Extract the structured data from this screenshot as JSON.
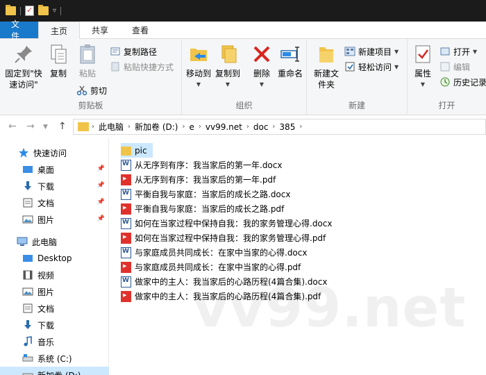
{
  "titlebar": {
    "title": ""
  },
  "tabs": [
    "文件",
    "主页",
    "共享",
    "查看"
  ],
  "ribbon": {
    "clipboard": {
      "pin": "固定到\"快速访问\"",
      "copy": "复制",
      "paste": "粘贴",
      "copy_path": "复制路径",
      "paste_shortcut": "粘贴快捷方式",
      "cut": "剪切",
      "label": "剪贴板"
    },
    "organize": {
      "move_to": "移动到",
      "copy_to": "复制到",
      "delete": "删除",
      "rename": "重命名",
      "label": "组织"
    },
    "new": {
      "new_folder": "新建文件夹",
      "new_item": "新建项目",
      "easy_access": "轻松访问",
      "label": "新建"
    },
    "open": {
      "properties": "属性",
      "open": "打开",
      "edit": "编辑",
      "history": "历史记录",
      "label": "打开"
    }
  },
  "address": {
    "crumbs": [
      "此电脑",
      "新加卷 (D:)",
      "e",
      "vv99.net",
      "doc",
      "385"
    ]
  },
  "navpane": {
    "quick_access": "快速访问",
    "quick_items": [
      "桌面",
      "下载",
      "文档",
      "图片"
    ],
    "this_pc": "此电脑",
    "pc_items": [
      "Desktop",
      "视频",
      "图片",
      "文档",
      "下载",
      "音乐",
      "系统 (C:)",
      "新加卷 (D:)"
    ]
  },
  "files": [
    {
      "name": "pic",
      "type": "folder"
    },
    {
      "name": "从无序到有序：我当家后的第一年.docx",
      "type": "docx"
    },
    {
      "name": "从无序到有序：我当家后的第一年.pdf",
      "type": "pdf"
    },
    {
      "name": "平衡自我与家庭：当家后的成长之路.docx",
      "type": "docx"
    },
    {
      "name": "平衡自我与家庭：当家后的成长之路.pdf",
      "type": "pdf"
    },
    {
      "name": "如何在当家过程中保持自我：我的家务管理心得.docx",
      "type": "docx"
    },
    {
      "name": "如何在当家过程中保持自我：我的家务管理心得.pdf",
      "type": "pdf"
    },
    {
      "name": "与家庭成员共同成长：在家中当家的心得.docx",
      "type": "docx"
    },
    {
      "name": "与家庭成员共同成长：在家中当家的心得.pdf",
      "type": "pdf"
    },
    {
      "name": "做家中的主人：我当家后的心路历程(4篇合集).docx",
      "type": "docx"
    },
    {
      "name": "做家中的主人：我当家后的心路历程(4篇合集).pdf",
      "type": "pdf"
    }
  ],
  "watermark": "vv99.net",
  "colors": {
    "file_tab": "#1979ca",
    "selection": "#cce8ff",
    "folder": "#f0c44a",
    "pdf": "#e0322c"
  }
}
